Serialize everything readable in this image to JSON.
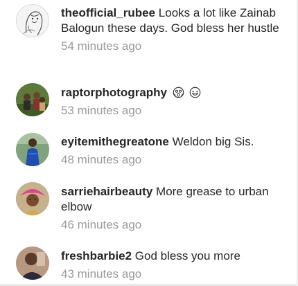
{
  "comments": [
    {
      "username": "theofficial_rubee",
      "text": "Looks a lot like Zainab Balogun these days. God bless her hustle",
      "time": "54 minutes ago",
      "avatar_icon": "sketch-portrait-avatar"
    },
    {
      "username": "raptorphotography",
      "text": "",
      "emojis": [
        "scream-emoji",
        "laughing-emoji"
      ],
      "time": "53 minutes ago",
      "avatar_icon": "outdoor-group-avatar"
    },
    {
      "username": "eyitemithegreatone",
      "text": "Weldon big Sis.",
      "time": "48 minutes ago",
      "avatar_icon": "blue-dress-avatar"
    },
    {
      "username": "sarriehairbeauty",
      "text": "More grease to urban elbow",
      "time": "46 minutes ago",
      "avatar_icon": "pink-gele-avatar"
    },
    {
      "username": "freshbarbie2",
      "text": "God bless you more",
      "time": "43 minutes ago",
      "avatar_icon": "selfie-avatar"
    }
  ],
  "colors": {
    "username": "#262626",
    "text": "#262626",
    "timestamp": "#9a9a9a",
    "background": "#ffffff"
  }
}
